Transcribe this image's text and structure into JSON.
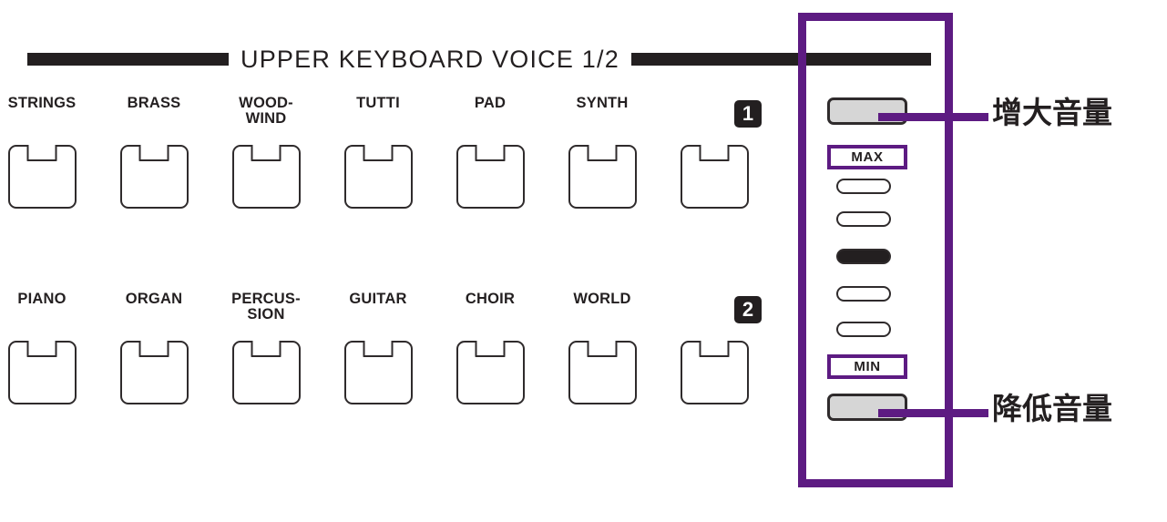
{
  "panel": {
    "title": "UPPER KEYBOARD VOICE 1/2",
    "accent_color": "#5d1b82",
    "ink_color": "#231f20",
    "button_face_color": "#d6d6d6"
  },
  "voice_rows": [
    {
      "badge": "1",
      "buttons": [
        {
          "label": "STRINGS"
        },
        {
          "label": "BRASS"
        },
        {
          "label": "WOOD-\nWIND"
        },
        {
          "label": "TUTTI"
        },
        {
          "label": "PAD"
        },
        {
          "label": "SYNTH"
        },
        {
          "label": ""
        }
      ]
    },
    {
      "badge": "2",
      "buttons": [
        {
          "label": "PIANO"
        },
        {
          "label": "ORGAN"
        },
        {
          "label": "PERCUS-\nSION"
        },
        {
          "label": "GUITAR"
        },
        {
          "label": "CHOIR"
        },
        {
          "label": "WORLD"
        },
        {
          "label": ""
        }
      ]
    }
  ],
  "volume": {
    "max_label": "MAX",
    "min_label": "MIN",
    "led_count": 5,
    "led_on_index": 2,
    "up_button_label": "",
    "down_button_label": ""
  },
  "callouts": {
    "increase": "增大音量",
    "decrease": "降低音量"
  }
}
